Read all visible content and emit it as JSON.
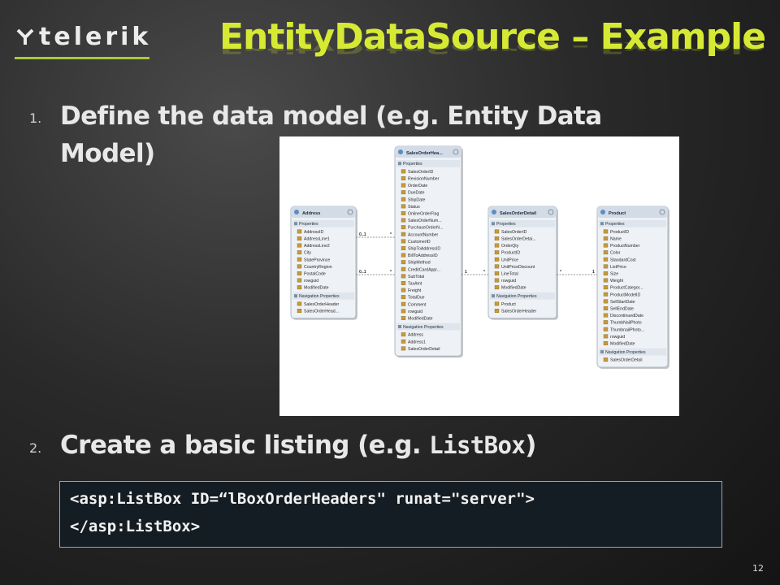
{
  "logo": {
    "text": "telerik"
  },
  "title": "EntityDataSource – Example",
  "items": [
    {
      "number": "1.",
      "text": "Define the data model (e.g. Entity Data Model)"
    },
    {
      "number": "2.",
      "text_before": "Create a basic listing (e.g. ",
      "text_mono": "ListBox",
      "text_after": ")"
    }
  ],
  "diagram": {
    "entities": [
      {
        "name": "Address",
        "sections": [
          {
            "label": "Properties",
            "items": [
              "AddressID",
              "AddressLine1",
              "AddressLine2",
              "City",
              "StateProvince",
              "CountryRegion",
              "PostalCode",
              "rowguid",
              "ModifiedDate"
            ]
          },
          {
            "label": "Navigation Properties",
            "items": [
              "SalesOrderHeader",
              "SalesOrderHead..."
            ]
          }
        ]
      },
      {
        "name": "SalesOrderHea...",
        "sections": [
          {
            "label": "Properties",
            "items": [
              "SalesOrderID",
              "RevisionNumber",
              "OrderDate",
              "DueDate",
              "ShipDate",
              "Status",
              "OnlineOrderFlag",
              "SalesOrderNum...",
              "PurchaseOrderN...",
              "AccountNumber",
              "CustomerID",
              "ShipToAddressID",
              "BillToAddressID",
              "ShipMethod",
              "CreditCardAppr...",
              "SubTotal",
              "TaxAmt",
              "Freight",
              "TotalDue",
              "Comment",
              "rowguid",
              "ModifiedDate"
            ]
          },
          {
            "label": "Navigation Properties",
            "items": [
              "Address",
              "Address1",
              "SalesOrderDetail"
            ]
          }
        ]
      },
      {
        "name": "SalesOrderDetail",
        "sections": [
          {
            "label": "Properties",
            "items": [
              "SalesOrderID",
              "SalesOrderDetai...",
              "OrderQty",
              "ProductID",
              "UnitPrice",
              "UnitPriceDiscount",
              "LineTotal",
              "rowguid",
              "ModifiedDate"
            ]
          },
          {
            "label": "Navigation Properties",
            "items": [
              "Product",
              "SalesOrderHeader"
            ]
          }
        ]
      },
      {
        "name": "Product",
        "sections": [
          {
            "label": "Properties",
            "items": [
              "ProductID",
              "Name",
              "ProductNumber",
              "Color",
              "StandardCost",
              "ListPrice",
              "Size",
              "Weight",
              "ProductCategor...",
              "ProductModelID",
              "SellStartDate",
              "SellEndDate",
              "DiscontinuedDate",
              "ThumbNailPhoto",
              "ThumbnailPhoto...",
              "rowguid",
              "ModifiedDate"
            ]
          },
          {
            "label": "Navigation Properties",
            "items": [
              "SalesOrderDetail"
            ]
          }
        ]
      }
    ],
    "multiplicities": [
      "0..1",
      "*",
      "0..1",
      "*",
      "1",
      "*",
      "*",
      "1"
    ]
  },
  "code": {
    "line1": "<asp:ListBox ID=“lBoxOrderHeaders\" runat=\"server\">",
    "line2": "</asp:ListBox>"
  },
  "page_number": "12",
  "colors": {
    "title": "#d6ea34",
    "accent": "#a8c83a",
    "code_bg": "#151d24"
  }
}
